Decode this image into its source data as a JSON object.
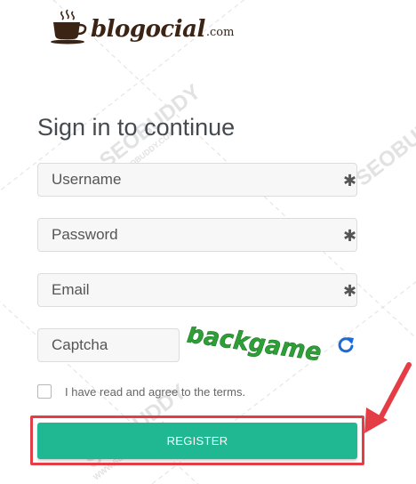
{
  "logo": {
    "word": "blogocial",
    "domain": ".com",
    "icon": "coffee-cup-icon"
  },
  "watermark": {
    "text": "SEOBUDDY",
    "url": "WWW.SEOBUDDY.COM"
  },
  "form": {
    "title": "Sign in to continue",
    "username_placeholder": "Username",
    "password_placeholder": "Password",
    "email_placeholder": "Email",
    "captcha_placeholder": "Captcha",
    "required_mark": "✱",
    "captcha_text": "backgame",
    "refresh_icon": "refresh-icon",
    "terms_label": "I have read and agree to the terms.",
    "register_label": "REGISTER"
  },
  "colors": {
    "accent": "#1fb892",
    "highlight": "#e53d45",
    "captcha": "#2e9e36",
    "logo": "#3c2415",
    "refresh": "#1e6bd6"
  }
}
